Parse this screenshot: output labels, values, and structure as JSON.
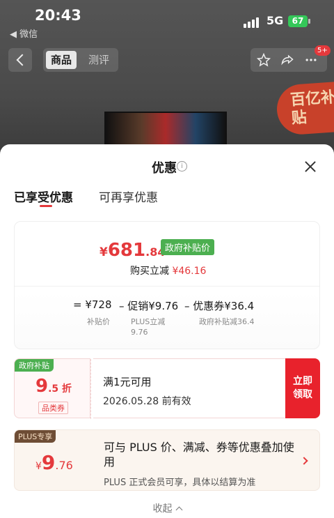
{
  "status_bar": {
    "time": "20:43",
    "back_app": "◀ 微信",
    "network": "5G",
    "battery": "67"
  },
  "product_nav": {
    "tabs": [
      "商品",
      "测评"
    ],
    "cart_badge": "5+",
    "subsidy_badge": "百亿补贴"
  },
  "sheet": {
    "title": "优惠",
    "tabs": [
      "已享受优惠",
      "可再享优惠"
    ],
    "summary": {
      "price_yen": "¥",
      "price_int": "681",
      "price_dec": ".84",
      "tag": "政府补贴价",
      "reduce_label": "购买立减",
      "reduce_amount": "¥46.16",
      "formula": [
        {
          "value": "= ¥728",
          "label": "补贴价"
        },
        {
          "value": "– 促销¥9.76",
          "label": "PLUS立减\n9.76"
        },
        {
          "value": "– 优惠券¥36.4",
          "label": "政府补贴减36.4"
        }
      ]
    },
    "coupon": {
      "flag": "政府补贴",
      "discount_big": "9",
      "discount_small": ".5 折",
      "category": "品类券",
      "condition": "满1元可用",
      "expiry": "2026.05.28 前有效",
      "claim_button": "立即领取"
    },
    "plus": {
      "flag": "PLUS专享",
      "yen": "¥",
      "price_big": "9",
      "price_small": ".76",
      "title": "可与 PLUS 价、满减、券等优惠叠加使用",
      "note": "PLUS 正式会员可享，具体以结算为准"
    },
    "collapse_label": "收起"
  },
  "colors": {
    "accent": "#e4393c",
    "gov_green": "#4caf50",
    "plus_brown": "#6e4d35"
  }
}
